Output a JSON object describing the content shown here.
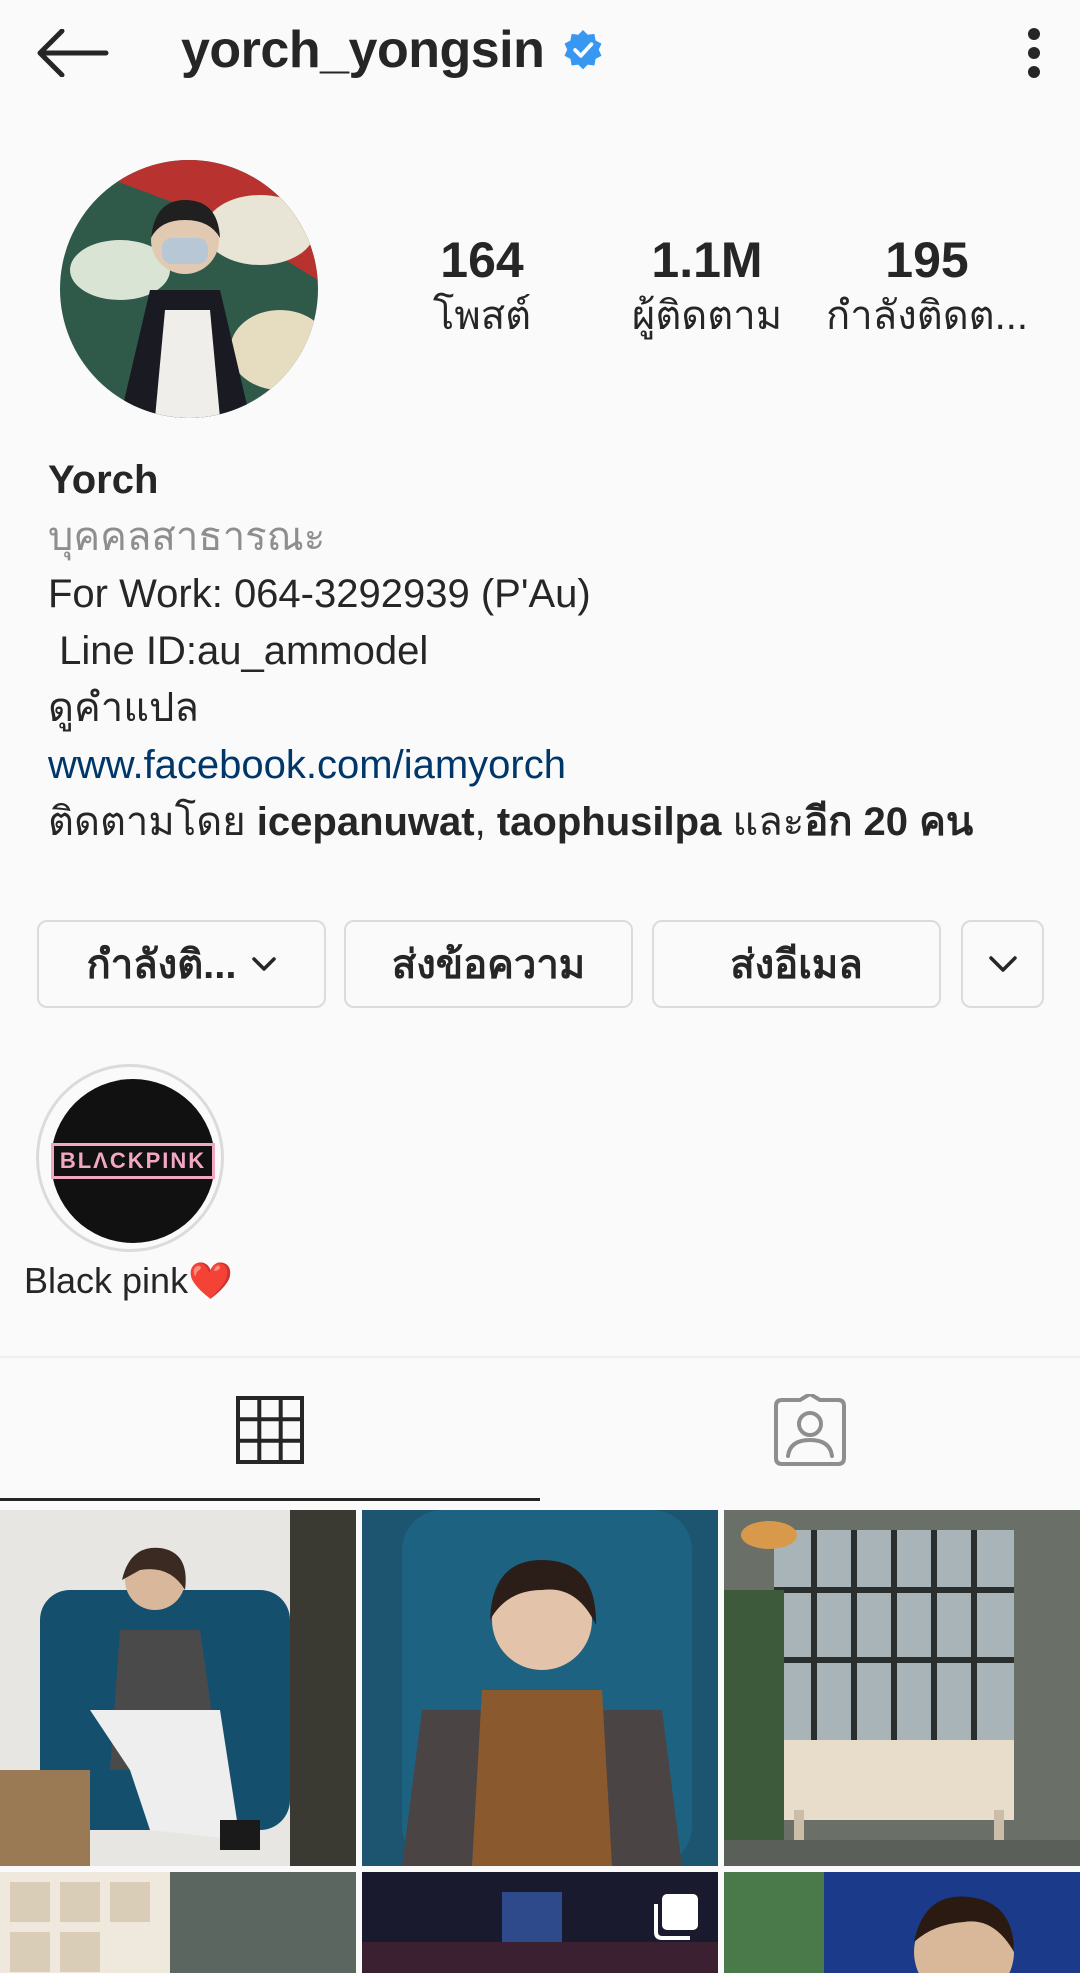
{
  "header": {
    "username": "yorch_yongsin",
    "verified": true
  },
  "stats": {
    "posts": {
      "value": "164",
      "label": "โพสต์"
    },
    "followers": {
      "value": "1.1M",
      "label": "ผู้ติดตาม"
    },
    "following": {
      "value": "195",
      "label": "กำลังติดต..."
    }
  },
  "bio": {
    "name": "Yorch",
    "category": "บุคคลสาธารณะ",
    "line1": "For Work: 064-3292939 (P'Au)",
    "line2": " Line ID:au_ammodel",
    "translate": "ดูคำแปล",
    "link": "www.facebook.com/iamyorch",
    "followed_by_prefix": "ติดตามโดย ",
    "followed_by_user1": "icepanuwat",
    "followed_by_sep": ", ",
    "followed_by_user2": "taophusilpa",
    "followed_by_and": " และ",
    "followed_by_more": "อีก 20 คน"
  },
  "buttons": {
    "following": "กำลังติ...",
    "message": "ส่งข้อความ",
    "email": "ส่งอีเมล"
  },
  "highlights": [
    {
      "label": "Black pink❤️",
      "cover_text": "BLΛCKPINK"
    }
  ],
  "tabs": [
    "grid-posts",
    "tagged"
  ],
  "colors": {
    "text": "#262626",
    "secondary": "#8e8e8e",
    "link": "#00376b",
    "verified": "#3897f0",
    "border": "#dbdbdb",
    "background": "#fafafa"
  }
}
